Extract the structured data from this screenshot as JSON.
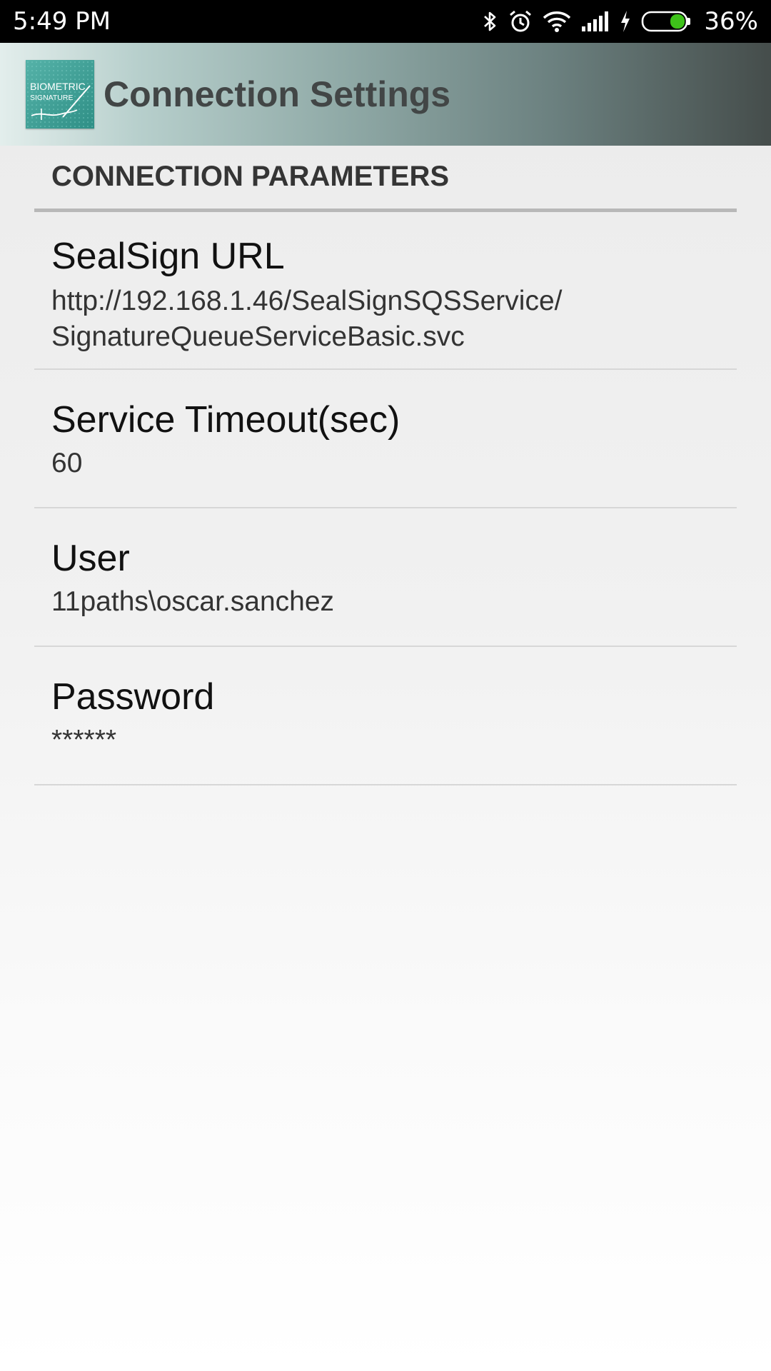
{
  "status_bar": {
    "time": "5:49 PM",
    "battery_percent": "36%",
    "battery_level": 0.36,
    "icons": [
      "bluetooth-icon",
      "alarm-icon",
      "wifi-icon",
      "signal-icon",
      "charging-icon",
      "battery-icon"
    ]
  },
  "action_bar": {
    "title": "Connection Settings",
    "logo_text_line1": "BIOMETRIC",
    "logo_text_line2": "SIGNATURE"
  },
  "category": {
    "title": "CONNECTION PARAMETERS"
  },
  "preferences": [
    {
      "title": "SealSign URL",
      "summary": "http://192.168.1.46/SealSignSQSService/\nSignatureQueueServiceBasic.svc"
    },
    {
      "title": "Service Timeout(sec)",
      "summary": "60"
    },
    {
      "title": "User",
      "summary": "11paths\\oscar.sanchez"
    },
    {
      "title": "Password",
      "summary": "******"
    }
  ],
  "colors": {
    "status_bar": "#000000",
    "battery_fill": "#3ec21a",
    "title_text": "#424646"
  }
}
